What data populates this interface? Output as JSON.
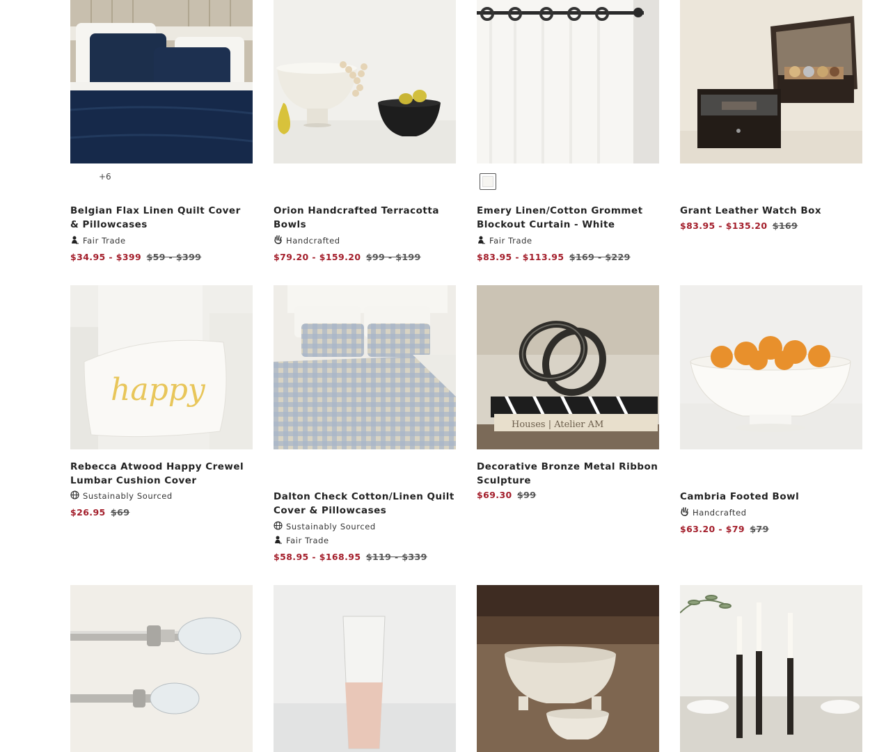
{
  "colors": {
    "sale": "#a31d2a",
    "text": "#222222",
    "swatch_white": "#f6f5f1"
  },
  "products": [
    {
      "id": "p1",
      "title": "Belgian Flax Linen Quilt Cover & Pillowcases",
      "badges": [
        "Fair Trade"
      ],
      "sale": "$34.95 - $399",
      "original": "$59 - $399",
      "extra": "+6"
    },
    {
      "id": "p2",
      "title": "Orion Handcrafted Terracotta Bowls",
      "badges": [
        "Handcrafted"
      ],
      "sale": "$79.20 - $159.20",
      "original": "$99 - $199"
    },
    {
      "id": "p3",
      "title": "Emery Linen/Cotton Grommet Blockout Curtain - White",
      "badges": [
        "Fair Trade"
      ],
      "sale": "$83.95 - $113.95",
      "original": "$169 - $229",
      "swatch": "white"
    },
    {
      "id": "p4",
      "title": "Grant Leather Watch Box",
      "badges": [],
      "sale": "$83.95 - $135.20",
      "original": "$169"
    },
    {
      "id": "p5",
      "title": "Rebecca Atwood Happy Crewel Lumbar Cushion Cover",
      "badges": [
        "Sustainably Sourced"
      ],
      "sale": "$26.95",
      "original": "$69",
      "image_text": "happy"
    },
    {
      "id": "p6",
      "title": "Dalton Check Cotton/Linen Quilt Cover & Pillowcases",
      "badges": [
        "Sustainably Sourced",
        "Fair Trade"
      ],
      "sale": "$58.95 - $168.95",
      "original": "$119 - $339"
    },
    {
      "id": "p7",
      "title": "Decorative Bronze Metal Ribbon Sculpture",
      "badges": [],
      "sale": "$69.30",
      "original": "$99",
      "image_text": "Houses | Atelier AM"
    },
    {
      "id": "p8",
      "title": "Cambria Footed Bowl",
      "badges": [
        "Handcrafted"
      ],
      "sale": "$63.20 - $79",
      "original": "$79"
    }
  ],
  "icons": {
    "Fair Trade": "fair-trade-icon",
    "Handcrafted": "handcrafted-icon",
    "Sustainably Sourced": "globe-icon"
  }
}
